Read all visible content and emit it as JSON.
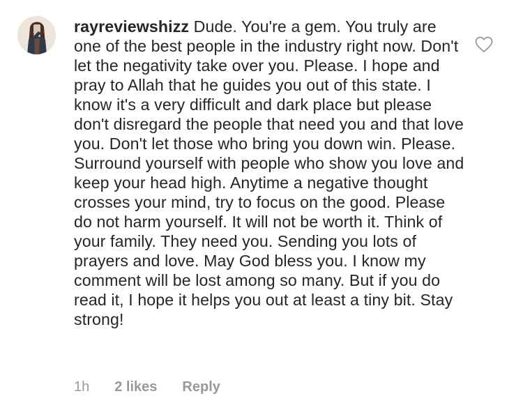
{
  "comment": {
    "username": "rayreviewshizz",
    "text": "Dude. You're a gem. You truly are one of the best people in the industry right now. Don't let the negativity take over you. Please. I hope and pray to Allah that he guides you out of this state. I know it's a very difficult and dark place but please don't disregard the people that need you and that love you. Don't let those who bring you down win. Please. Surround yourself with people who show you love and keep your head high. Anytime a negative thought crosses your mind, try to focus on the good. Please do not harm yourself. It will not be worth it. Think of your family. They need you. Sending you lots of prayers and love. May God bless you. I know my comment will be lost among so many. But if you do read it, I hope it helps you out at least a tiny bit. Stay strong!",
    "time": "1h",
    "likes": "2 likes",
    "reply_label": "Reply",
    "like_icon": "heart-outline-icon"
  },
  "colors": {
    "text": "#262626",
    "meta": "#999999",
    "icon": "#999999"
  }
}
